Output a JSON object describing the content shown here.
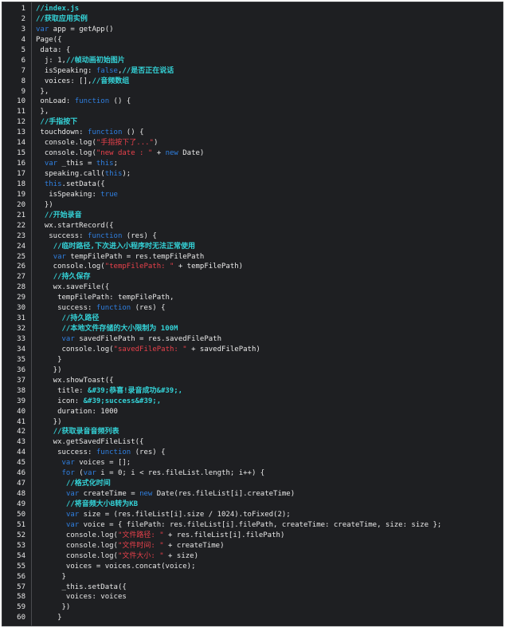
{
  "editor": {
    "lines": [
      [
        {
          "t": "c",
          "v": "//index.js"
        }
      ],
      [
        {
          "t": "c",
          "v": "//获取应用实例"
        }
      ],
      [
        {
          "t": "k",
          "v": "var"
        },
        {
          "t": "p",
          "v": " app = getApp()"
        }
      ],
      [
        {
          "t": "p",
          "v": "Page({"
        }
      ],
      [
        {
          "t": "p",
          "v": " data: {"
        }
      ],
      [
        {
          "t": "p",
          "v": "  j: 1,"
        },
        {
          "t": "c",
          "v": "//帧动画初始图片"
        }
      ],
      [
        {
          "t": "p",
          "v": "  isSpeaking: "
        },
        {
          "t": "k",
          "v": "false"
        },
        {
          "t": "p",
          "v": ","
        },
        {
          "t": "c",
          "v": "//是否正在说话"
        }
      ],
      [
        {
          "t": "p",
          "v": "  voices: [],"
        },
        {
          "t": "c",
          "v": "//音频数组"
        }
      ],
      [
        {
          "t": "p",
          "v": " },"
        }
      ],
      [
        {
          "t": "p",
          "v": " onLoad: "
        },
        {
          "t": "k",
          "v": "function"
        },
        {
          "t": "p",
          "v": " () {"
        }
      ],
      [
        {
          "t": "p",
          "v": " },"
        }
      ],
      [
        {
          "t": "p",
          "v": " "
        },
        {
          "t": "c",
          "v": "//手指按下"
        }
      ],
      [
        {
          "t": "p",
          "v": " touchdown: "
        },
        {
          "t": "k",
          "v": "function"
        },
        {
          "t": "p",
          "v": " () {"
        }
      ],
      [
        {
          "t": "p",
          "v": "  console.log("
        },
        {
          "t": "s",
          "v": "\"手指按下了...\""
        },
        {
          "t": "p",
          "v": ")"
        }
      ],
      [
        {
          "t": "p",
          "v": "  console.log("
        },
        {
          "t": "s",
          "v": "\"new date : \""
        },
        {
          "t": "p",
          "v": " + "
        },
        {
          "t": "k",
          "v": "new"
        },
        {
          "t": "p",
          "v": " Date)"
        }
      ],
      [
        {
          "t": "p",
          "v": "  "
        },
        {
          "t": "k",
          "v": "var"
        },
        {
          "t": "p",
          "v": " _this = "
        },
        {
          "t": "k",
          "v": "this"
        },
        {
          "t": "p",
          "v": ";"
        }
      ],
      [
        {
          "t": "p",
          "v": "  speaking.call("
        },
        {
          "t": "k",
          "v": "this"
        },
        {
          "t": "p",
          "v": ");"
        }
      ],
      [
        {
          "t": "p",
          "v": "  "
        },
        {
          "t": "k",
          "v": "this"
        },
        {
          "t": "p",
          "v": ".setData({"
        }
      ],
      [
        {
          "t": "p",
          "v": "   isSpeaking: "
        },
        {
          "t": "k",
          "v": "true"
        }
      ],
      [
        {
          "t": "p",
          "v": "  })"
        }
      ],
      [
        {
          "t": "p",
          "v": "  "
        },
        {
          "t": "c",
          "v": "//开始录音"
        }
      ],
      [
        {
          "t": "p",
          "v": "  wx.startRecord({"
        }
      ],
      [
        {
          "t": "p",
          "v": "   success: "
        },
        {
          "t": "k",
          "v": "function"
        },
        {
          "t": "p",
          "v": " (res) {"
        }
      ],
      [
        {
          "t": "p",
          "v": "    "
        },
        {
          "t": "c",
          "v": "//临时路径,下次进入小程序时无法正常使用"
        }
      ],
      [
        {
          "t": "p",
          "v": "    "
        },
        {
          "t": "k",
          "v": "var"
        },
        {
          "t": "p",
          "v": " tempFilePath = res.tempFilePath"
        }
      ],
      [
        {
          "t": "p",
          "v": "    console.log("
        },
        {
          "t": "s",
          "v": "\"tempFilePath: \""
        },
        {
          "t": "p",
          "v": " + tempFilePath)"
        }
      ],
      [
        {
          "t": "p",
          "v": "    "
        },
        {
          "t": "c",
          "v": "//持久保存"
        }
      ],
      [
        {
          "t": "p",
          "v": "    wx.saveFile({"
        }
      ],
      [
        {
          "t": "p",
          "v": "     tempFilePath: tempFilePath,"
        }
      ],
      [
        {
          "t": "p",
          "v": "     success: "
        },
        {
          "t": "k",
          "v": "function"
        },
        {
          "t": "p",
          "v": " (res) {"
        }
      ],
      [
        {
          "t": "p",
          "v": "      "
        },
        {
          "t": "c",
          "v": "//持久路径"
        }
      ],
      [
        {
          "t": "p",
          "v": "      "
        },
        {
          "t": "c",
          "v": "//本地文件存储的大小限制为 100M"
        }
      ],
      [
        {
          "t": "p",
          "v": "      "
        },
        {
          "t": "k",
          "v": "var"
        },
        {
          "t": "p",
          "v": " savedFilePath = res.savedFilePath"
        }
      ],
      [
        {
          "t": "p",
          "v": "      console.log("
        },
        {
          "t": "s",
          "v": "\"savedFilePath: \""
        },
        {
          "t": "p",
          "v": " + savedFilePath)"
        }
      ],
      [
        {
          "t": "p",
          "v": "     }"
        }
      ],
      [
        {
          "t": "p",
          "v": "    })"
        }
      ],
      [
        {
          "t": "p",
          "v": "    wx.showToast({"
        }
      ],
      [
        {
          "t": "p",
          "v": "     title: "
        },
        {
          "t": "b",
          "v": "&#39;恭喜!录音成功&#39;,"
        }
      ],
      [
        {
          "t": "p",
          "v": "     icon: "
        },
        {
          "t": "b",
          "v": "&#39;success&#39;,"
        }
      ],
      [
        {
          "t": "p",
          "v": "     duration: 1000"
        }
      ],
      [
        {
          "t": "p",
          "v": "    })"
        }
      ],
      [
        {
          "t": "p",
          "v": "    "
        },
        {
          "t": "c",
          "v": "//获取录音音频列表"
        }
      ],
      [
        {
          "t": "p",
          "v": "    wx.getSavedFileList({"
        }
      ],
      [
        {
          "t": "p",
          "v": "     success: "
        },
        {
          "t": "k",
          "v": "function"
        },
        {
          "t": "p",
          "v": " (res) {"
        }
      ],
      [
        {
          "t": "p",
          "v": "      "
        },
        {
          "t": "k",
          "v": "var"
        },
        {
          "t": "p",
          "v": " voices = [];"
        }
      ],
      [
        {
          "t": "p",
          "v": "      "
        },
        {
          "t": "k",
          "v": "for"
        },
        {
          "t": "p",
          "v": " ("
        },
        {
          "t": "k",
          "v": "var"
        },
        {
          "t": "p",
          "v": " i = 0; i < res.fileList.length; i++) {"
        }
      ],
      [
        {
          "t": "p",
          "v": "       "
        },
        {
          "t": "c",
          "v": "//格式化时间"
        }
      ],
      [
        {
          "t": "p",
          "v": "       "
        },
        {
          "t": "k",
          "v": "var"
        },
        {
          "t": "p",
          "v": " createTime = "
        },
        {
          "t": "k",
          "v": "new"
        },
        {
          "t": "p",
          "v": " Date(res.fileList[i].createTime)"
        }
      ],
      [
        {
          "t": "p",
          "v": "       "
        },
        {
          "t": "c",
          "v": "//将音频大小B转为KB"
        }
      ],
      [
        {
          "t": "p",
          "v": "       "
        },
        {
          "t": "k",
          "v": "var"
        },
        {
          "t": "p",
          "v": " size = (res.fileList[i].size / 1024).toFixed(2);"
        }
      ],
      [
        {
          "t": "p",
          "v": "       "
        },
        {
          "t": "k",
          "v": "var"
        },
        {
          "t": "p",
          "v": " voice = { filePath: res.fileList[i].filePath, createTime: createTime, size: size };"
        }
      ],
      [
        {
          "t": "p",
          "v": "       console.log("
        },
        {
          "t": "s",
          "v": "\"文件路径: \""
        },
        {
          "t": "p",
          "v": " + res.fileList[i].filePath)"
        }
      ],
      [
        {
          "t": "p",
          "v": "       console.log("
        },
        {
          "t": "s",
          "v": "\"文件时间: \""
        },
        {
          "t": "p",
          "v": " + createTime)"
        }
      ],
      [
        {
          "t": "p",
          "v": "       console.log("
        },
        {
          "t": "s",
          "v": "\"文件大小: \""
        },
        {
          "t": "p",
          "v": " + size)"
        }
      ],
      [
        {
          "t": "p",
          "v": "       voices = voices.concat(voice);"
        }
      ],
      [
        {
          "t": "p",
          "v": "      }"
        }
      ],
      [
        {
          "t": "p",
          "v": "      _this.setData({"
        }
      ],
      [
        {
          "t": "p",
          "v": "       voices: voices"
        }
      ],
      [
        {
          "t": "p",
          "v": "      })"
        }
      ],
      [
        {
          "t": "p",
          "v": "     }"
        }
      ]
    ]
  }
}
